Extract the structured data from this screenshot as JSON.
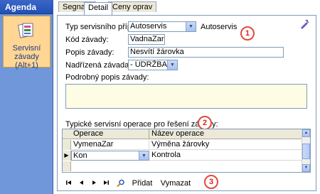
{
  "agenda": {
    "title": "Agenda",
    "item_line1": "Servisní závady",
    "item_line2": "(Alt+1)"
  },
  "tabs": [
    {
      "label": "Segnam",
      "active": false
    },
    {
      "label": "Detail",
      "active": true
    },
    {
      "label": "Ceny oprav",
      "active": false
    }
  ],
  "form": {
    "typ_label": "Typ servisního případu:",
    "typ_value": "Autoservis",
    "typ_extra": "Autoservis",
    "kod_label": "Kód závady:",
    "kod_value": "VadnaZar",
    "popis_label": "Popis závady:",
    "popis_value": "Nesvítí žárovka",
    "nadrizena_label": "Nadřízená závada:",
    "nadrizena_value": "- ÚDRŽBA",
    "podrobny_label": "Podrobný popis závady:",
    "podrobny_value": ""
  },
  "operations": {
    "label": "Typické servisní operace pro řešení závady:",
    "columns": [
      "Operace",
      "Název operace"
    ],
    "rows": [
      {
        "op": "VymenaZar",
        "name": "Výměna žárovky"
      },
      {
        "op": "Kon",
        "name": "Kontrola"
      }
    ]
  },
  "nav": {
    "add_label": "Přidat",
    "delete_label": "Vymazat"
  },
  "badges": [
    "1",
    "2",
    "3"
  ],
  "colors": {
    "agenda_bg": "#6f97d9",
    "selected_item_bg": "#ffd693",
    "textarea_bg": "#fefde3",
    "badge": "#e24a3d"
  }
}
